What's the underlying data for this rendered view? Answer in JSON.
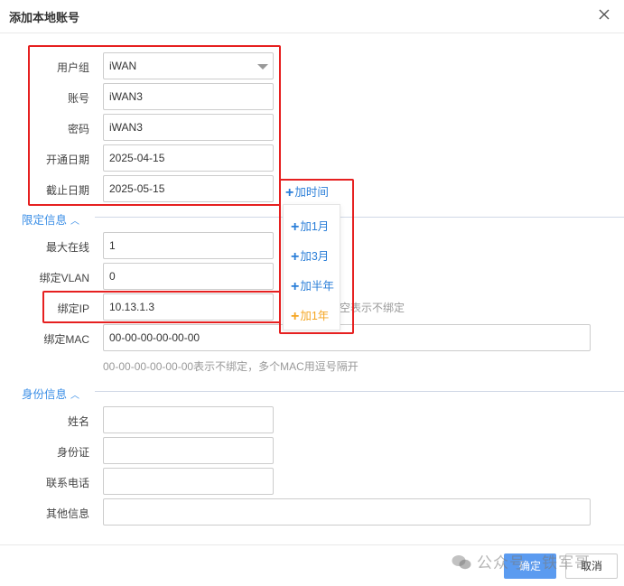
{
  "dialog": {
    "title": "添加本地账号",
    "close_icon": "close-icon"
  },
  "account": {
    "group_label": "用户组",
    "group_value": "iWAN",
    "account_label": "账号",
    "account_value": "iWAN3",
    "password_label": "密码",
    "password_value": "iWAN3",
    "open_date_label": "开通日期",
    "open_date_value": "2025-04-15",
    "expire_date_label": "截止日期",
    "expire_date_value": "2025-05-15",
    "add_time_label": "加时间"
  },
  "add_time_menu": {
    "items": [
      "加1月",
      "加3月",
      "加半年",
      "加1年"
    ],
    "highlighted": "加1年"
  },
  "limits": {
    "section_title": "限定信息",
    "max_online_label": "最大在线",
    "max_online_value": "1",
    "bind_vlan_label": "绑定VLAN",
    "bind_vlan_value": "0",
    "bind_ip_label": "绑定IP",
    "bind_ip_value": "10.13.1.3",
    "bind_ip_hint_partial": "空表示不绑定",
    "bind_mac_label": "绑定MAC",
    "bind_mac_value": "00-00-00-00-00-00",
    "bind_mac_hint": "00-00-00-00-00-00表示不绑定，多个MAC用逗号隔开"
  },
  "identity": {
    "section_title": "身份信息",
    "name_label": "姓名",
    "name_value": "",
    "id_card_label": "身份证",
    "id_card_value": "",
    "phone_label": "联系电话",
    "phone_value": "",
    "other_label": "其他信息",
    "other_value": ""
  },
  "footer": {
    "ok_label": "确定",
    "cancel_label": "取消"
  },
  "watermark": {
    "text": "公众号 · 铁军哥"
  },
  "colors": {
    "accent": "#2a7ed8",
    "highlight": "#f5a623",
    "annotation_red": "#e62020",
    "primary_button": "#5b9bf0"
  }
}
